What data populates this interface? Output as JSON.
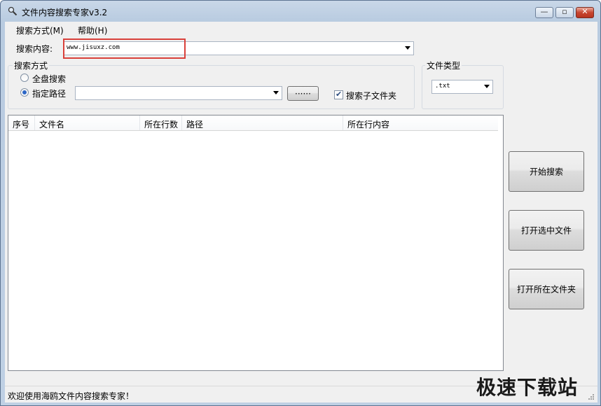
{
  "window": {
    "title": "文件内容搜索专家v3.2"
  },
  "menu": [
    {
      "label": "搜索方式(M)"
    },
    {
      "label": "帮助(H)"
    }
  ],
  "search": {
    "label": "搜索内容:",
    "value": "www.jisuxz.com"
  },
  "search_mode": {
    "title": "搜索方式",
    "option_all": "全盘搜索",
    "option_path": "指定路径",
    "selected": "指定路径",
    "path_value": "",
    "browse_label": "······",
    "subfolder_label": "搜索子文件夹",
    "subfolder_checked": true
  },
  "file_type": {
    "title": "文件类型",
    "value": ".txt"
  },
  "results": {
    "columns": [
      "序号",
      "文件名",
      "所在行数",
      "路径",
      "所在行内容"
    ],
    "rows": []
  },
  "actions": {
    "start": "开始搜索",
    "open_selected": "打开选中文件",
    "open_folder": "打开所在文件夹"
  },
  "status": {
    "text": "欢迎使用海鸥文件内容搜索专家！"
  },
  "watermark": "极速下载站",
  "icons": {
    "app": "magnifier-icon",
    "minimize": "minimize-icon",
    "maximize": "maximize-icon",
    "close": "close-icon"
  }
}
